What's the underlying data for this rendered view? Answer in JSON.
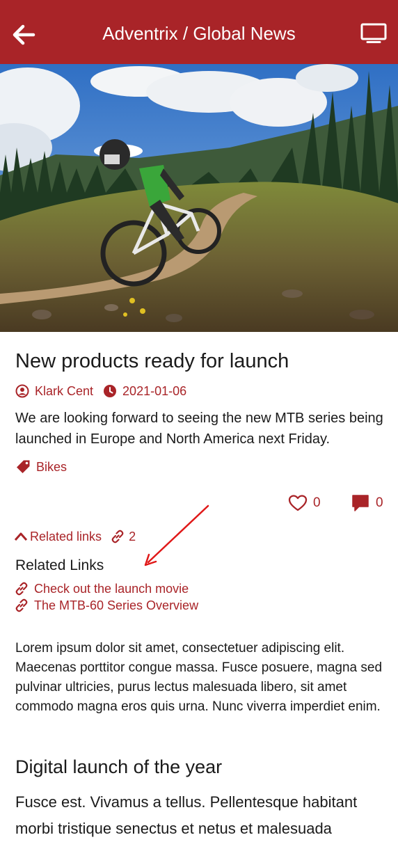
{
  "header": {
    "title": "Adventrix / Global News",
    "back_icon": "arrow-left-icon",
    "screen_icon": "monitor-icon",
    "background_color": "#a92428"
  },
  "article": {
    "hero_image": "mountain-biker-on-trail",
    "title": "New products ready for launch",
    "author": "Klark Cent",
    "date": "2021-01-06",
    "summary": "We are looking forward to seeing the new MTB series being launched in Europe and North America next Friday.",
    "tag": "Bikes",
    "likes": "0",
    "comments": "0",
    "accent_color": "#a92428"
  },
  "related": {
    "toggle_label": "Related links",
    "count": "2",
    "heading": "Related Links",
    "links": [
      {
        "label": "Check out the launch movie"
      },
      {
        "label": "The MTB-60 Series Overview"
      }
    ]
  },
  "body": {
    "paragraph": "Lorem ipsum dolor sit amet, consectetuer adipiscing elit. Maecenas porttitor congue massa. Fusce posuere, magna sed pulvinar ultricies, purus lectus malesuada libero, sit amet commodo magna eros quis urna. Nunc viverra imperdiet enim.",
    "section_heading": "Digital launch of the year",
    "section_text": "Fusce est. Vivamus a tellus. Pellentesque habitant morbi tristique senectus et netus et malesuada"
  }
}
